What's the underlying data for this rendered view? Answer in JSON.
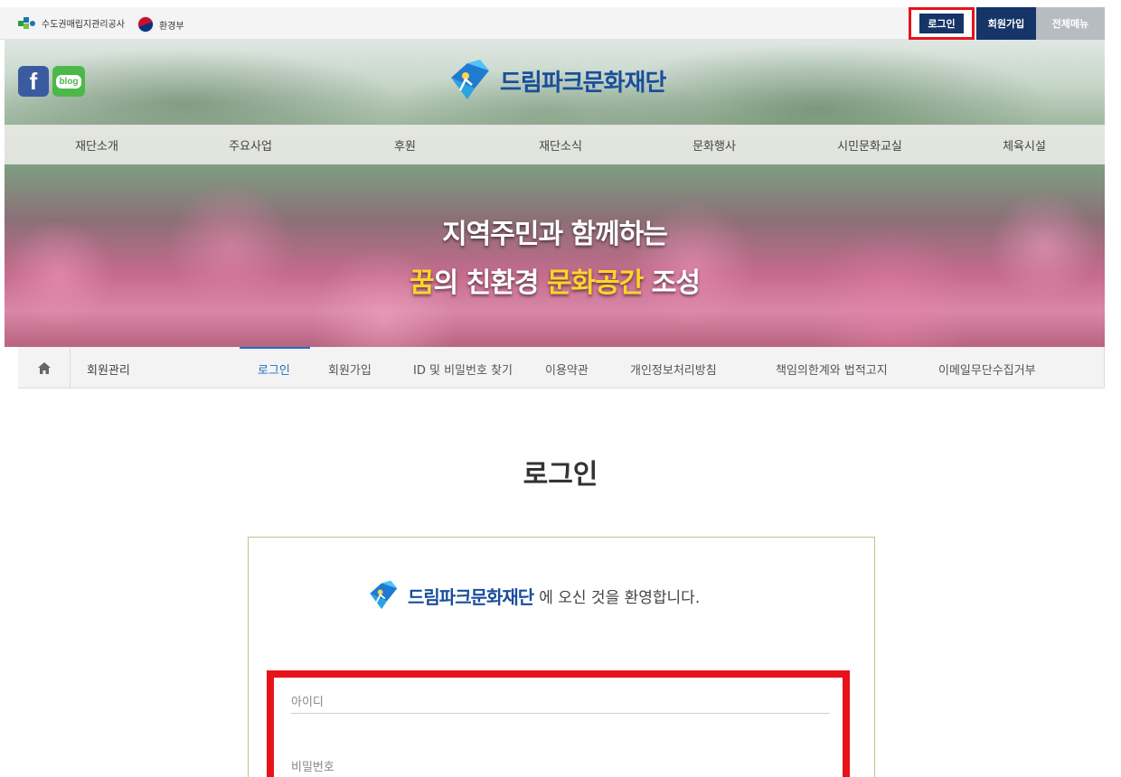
{
  "topbar": {
    "org_kwater": "수도권매립지관리공사",
    "org_me": "환경부",
    "login": "로그인",
    "join": "회원가입",
    "all_menu": "전체메뉴"
  },
  "header": {
    "sns_facebook": "f",
    "sns_blog": "blog",
    "logo_text": "드림파크문화재단"
  },
  "gnb": [
    "재단소개",
    "주요사업",
    "후원",
    "재단소식",
    "문화행사",
    "시민문화교실",
    "체육시설"
  ],
  "slogan": {
    "line1": "지역주민과 함께하는",
    "line2_a": "꿈",
    "line2_b": "의 친환경 ",
    "line2_c": "문화공간",
    "line2_d": " 조성"
  },
  "lnb": {
    "category": "회원관리",
    "items": [
      "로그인",
      "회원가입",
      "ID 및 비밀번호 찾기",
      "이용약관",
      "개인정보처리방침",
      "책임의한계와 법적고지",
      "이메일무단수집거부"
    ],
    "active_index": 0
  },
  "main": {
    "title": "로그인",
    "welcome_logo": "드림파크문화재단",
    "welcome_text": "에 오신 것을 환영합니다.",
    "id_placeholder": "아이디",
    "pw_placeholder": "비밀번호"
  },
  "colors": {
    "navy": "#153468",
    "accent_blue": "#1d6fc8",
    "highlight_red": "#e8131a",
    "slogan_yellow": "#ffd42a"
  }
}
